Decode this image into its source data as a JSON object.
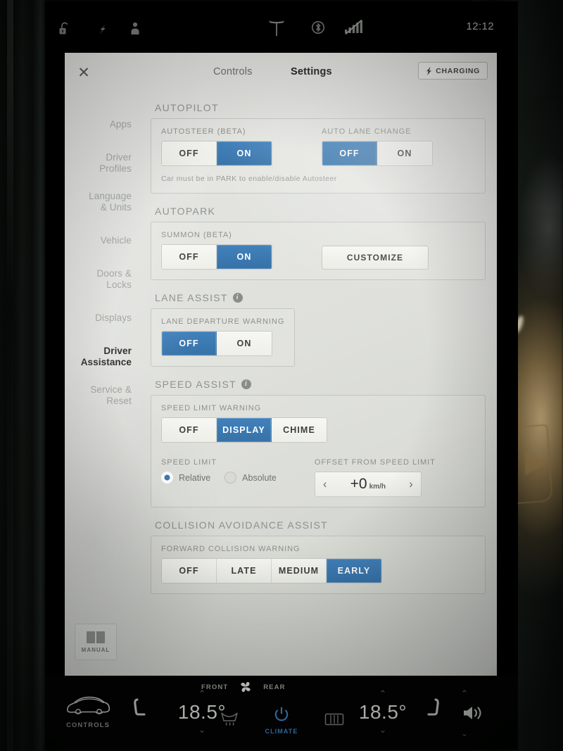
{
  "statusbar": {
    "icons": [
      "unlock-icon",
      "charging-bolt-icon",
      "driver-profile-icon",
      "tesla-logo-icon",
      "bluetooth-icon",
      "cellular-signal-off-icon"
    ],
    "time": "12:12"
  },
  "header": {
    "close_label": "✕",
    "tab_controls": "Controls",
    "tab_settings": "Settings",
    "charging_label": "CHARGING"
  },
  "sidebar": {
    "items": [
      {
        "label": "Apps",
        "lines": [
          "Apps"
        ],
        "active": false
      },
      {
        "label": "Driver Profiles",
        "lines": [
          "Driver",
          "Profiles"
        ],
        "active": false
      },
      {
        "label": "Language & Units",
        "lines": [
          "Language",
          "& Units"
        ],
        "active": false
      },
      {
        "label": "Vehicle",
        "lines": [
          "Vehicle"
        ],
        "active": false
      },
      {
        "label": "Doors & Locks",
        "lines": [
          "Doors &",
          "Locks"
        ],
        "active": false
      },
      {
        "label": "Displays",
        "lines": [
          "Displays"
        ],
        "active": false
      },
      {
        "label": "Driver Assistance",
        "lines": [
          "Driver",
          "Assistance"
        ],
        "active": true
      },
      {
        "label": "Service & Reset",
        "lines": [
          "Service &",
          "Reset"
        ],
        "active": false
      }
    ]
  },
  "sections": {
    "autopilot": {
      "title": "AUTOPILOT",
      "autosteer": {
        "label": "AUTOSTEER (BETA)",
        "options": [
          "OFF",
          "ON"
        ],
        "selected": "ON"
      },
      "auto_lane_change": {
        "label": "AUTO LANE CHANGE",
        "options": [
          "OFF",
          "ON"
        ],
        "selected": "OFF"
      },
      "hint": "Car must be in PARK to enable/disable Autosteer"
    },
    "autopark": {
      "title": "AUTOPARK",
      "summon": {
        "label": "SUMMON (BETA)",
        "options": [
          "OFF",
          "ON"
        ],
        "selected": "ON"
      },
      "customize_label": "CUSTOMIZE"
    },
    "lane_assist": {
      "title": "LANE ASSIST",
      "has_info": true,
      "lane_departure_warning": {
        "label": "LANE DEPARTURE WARNING",
        "options": [
          "OFF",
          "ON"
        ],
        "selected": "OFF"
      }
    },
    "speed_assist": {
      "title": "SPEED ASSIST",
      "has_info": true,
      "speed_limit_warning": {
        "label": "SPEED LIMIT WARNING",
        "options": [
          "OFF",
          "DISPLAY",
          "CHIME"
        ],
        "selected": "DISPLAY"
      },
      "speed_limit": {
        "label": "SPEED LIMIT",
        "options": [
          "Relative",
          "Absolute"
        ],
        "selected": "Relative"
      },
      "offset": {
        "label": "OFFSET FROM SPEED LIMIT",
        "value": "+0",
        "unit": "km/h",
        "prev_icon": "chevron-left-icon",
        "next_icon": "chevron-right-icon"
      }
    },
    "collision": {
      "title": "COLLISION AVOIDANCE ASSIST",
      "forward_collision_warning": {
        "label": "FORWARD COLLISION WARNING",
        "options": [
          "OFF",
          "LATE",
          "MEDIUM",
          "EARLY"
        ],
        "selected": "EARLY"
      }
    }
  },
  "manual_button": {
    "label": "MANUAL",
    "icon": "book-icon"
  },
  "climate_bar": {
    "controls_label": "CONTROLS",
    "front_label": "FRONT",
    "rear_label": "REAR",
    "fan_icon": "fan-icon",
    "left_temp": "18.5°",
    "right_temp": "18.5°",
    "climate_label": "CLIMATE",
    "power_icon": "power-icon",
    "left_seat_icon": "seat-heater-icon",
    "right_seat_icon": "seat-heater-icon",
    "defrost_front_icon": "front-defrost-icon",
    "defrost_rear_icon": "rear-defrost-icon",
    "volume_icon": "volume-icon",
    "car_icon": "car-icon"
  },
  "colors": {
    "accent_blue": "#3c79b2",
    "panel_bg": "#e2e3df",
    "text_muted": "#8d918b",
    "text_dark": "#222522"
  }
}
